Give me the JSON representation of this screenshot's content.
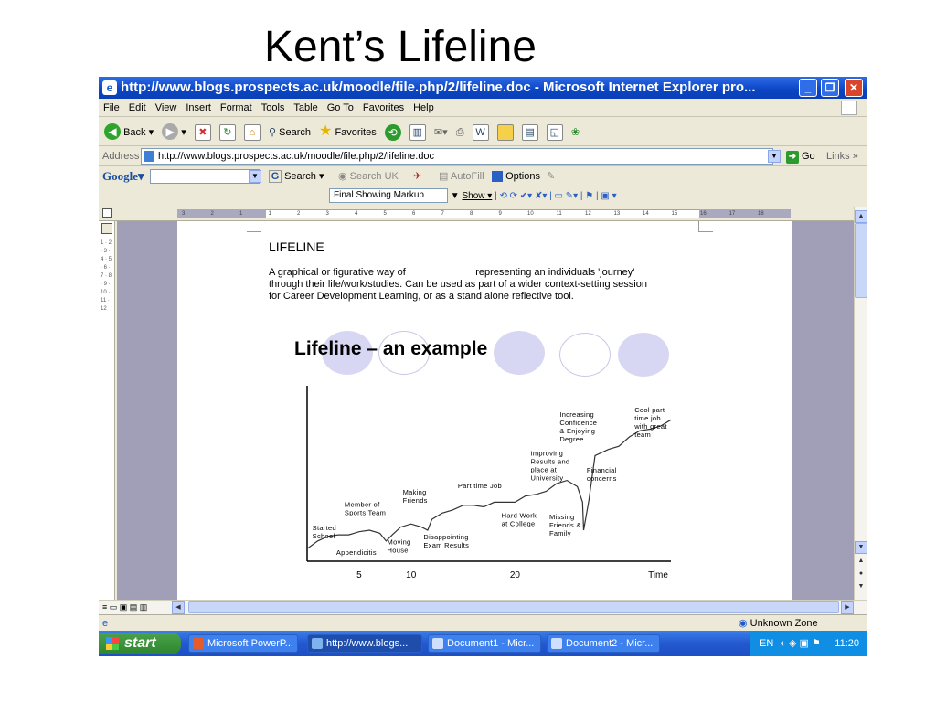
{
  "slide": {
    "title": "Kent’s Lifeline"
  },
  "window": {
    "title": "http://www.blogs.prospects.ac.uk/moodle/file.php/2/lifeline.doc - Microsoft Internet Explorer pro..."
  },
  "menu": [
    "File",
    "Edit",
    "View",
    "Insert",
    "Format",
    "Tools",
    "Table",
    "Go To",
    "Favorites",
    "Help"
  ],
  "toolbar": {
    "back": "Back",
    "search": "Search",
    "favorites": "Favorites"
  },
  "address": {
    "label": "Address",
    "url": "http://www.blogs.prospects.ac.uk/moodle/file.php/2/lifeline.doc",
    "go": "Go",
    "links": "Links"
  },
  "google": {
    "logo": "Google",
    "search": "Search",
    "search_uk": "Search UK",
    "autofill": "AutoFill",
    "options": "Options"
  },
  "review": {
    "markup": "Final Showing Markup",
    "show": "Show"
  },
  "ruler_numbers": [
    "3",
    "2",
    "1",
    "1",
    "2",
    "3",
    "4",
    "5",
    "6",
    "7",
    "8",
    "9",
    "10",
    "11",
    "12",
    "13",
    "14",
    "15",
    "16",
    "17",
    "18"
  ],
  "vruler_text": "1 · 2 · 3 · 4 · 5 · 6 · 7 · 8 · 9 · 10 · 11 · 12",
  "doc": {
    "heading": "LIFELINE",
    "para_lines": [
      "A graphical or figurative way of                         representing an individuals 'journey'",
      "through their life/work/studies.  Can be used as part of a wider context-setting session",
      "for Career Development Learning, or as a stand alone reflective tool."
    ],
    "lifeline_title": "Lifeline – an example"
  },
  "chart_data": {
    "type": "line",
    "title": "",
    "xlabel": "Time",
    "ylabel": "",
    "x_ticks": [
      5,
      10,
      20
    ],
    "xlim": [
      0,
      32
    ],
    "ylim": [
      0,
      1
    ],
    "series": [
      {
        "x": [
          0,
          1,
          2,
          3,
          4,
          4.5,
          5,
          6,
          7,
          7.6,
          8.2,
          9,
          10,
          11,
          11.6,
          12,
          13,
          14,
          15,
          16,
          17,
          18,
          19,
          20,
          21,
          22,
          23,
          24,
          25,
          26,
          26.5,
          26.6,
          27.1,
          27.7,
          29,
          30,
          31,
          32,
          33,
          34,
          35
        ],
        "y": [
          0.08,
          0.13,
          0.16,
          0.17,
          0.17,
          0.18,
          0.19,
          0.2,
          0.18,
          0.13,
          0.17,
          0.22,
          0.24,
          0.22,
          0.2,
          0.27,
          0.31,
          0.33,
          0.36,
          0.36,
          0.35,
          0.38,
          0.38,
          0.38,
          0.42,
          0.43,
          0.45,
          0.5,
          0.52,
          0.48,
          0.38,
          0.2,
          0.39,
          0.68,
          0.72,
          0.74,
          0.8,
          0.84,
          0.85,
          0.87,
          0.91
        ]
      }
    ],
    "annotations": [
      {
        "lines": [
          "Started",
          "School"
        ],
        "x": 0.5,
        "y": 0.2
      },
      {
        "lines": [
          "Appendicitis"
        ],
        "x": 2.8,
        "y": 0.04
      },
      {
        "lines": [
          "Member of",
          "Sports Team"
        ],
        "x": 3.6,
        "y": 0.35
      },
      {
        "lines": [
          "Moving",
          "House"
        ],
        "x": 7.7,
        "y": 0.11
      },
      {
        "lines": [
          "Making",
          "Friends"
        ],
        "x": 9.2,
        "y": 0.43
      },
      {
        "lines": [
          "Disappointing",
          "Exam Results"
        ],
        "x": 11.2,
        "y": 0.14
      },
      {
        "lines": [
          "Part time Job"
        ],
        "x": 14.5,
        "y": 0.47
      },
      {
        "lines": [
          "Hard Work",
          "at College"
        ],
        "x": 18.7,
        "y": 0.28
      },
      {
        "lines": [
          "Improving",
          "Results and",
          "place at",
          "University"
        ],
        "x": 21.5,
        "y": 0.68
      },
      {
        "lines": [
          "Missing",
          "Friends &",
          "Family"
        ],
        "x": 23.3,
        "y": 0.27
      },
      {
        "lines": [
          "Increasing",
          "Confidence",
          "& Enjoying",
          "Degree"
        ],
        "x": 24.3,
        "y": 0.93
      },
      {
        "lines": [
          "Financial",
          "concerns"
        ],
        "x": 26.9,
        "y": 0.57
      },
      {
        "lines": [
          "Cool part",
          "time job",
          "with great",
          "team"
        ],
        "x": 31.5,
        "y": 0.96
      }
    ]
  },
  "status": {
    "zone": "Unknown Zone"
  },
  "taskbar": {
    "start": "start",
    "tasks": [
      "Microsoft PowerP...",
      "http://www.blogs...",
      "Document1 - Micr...",
      "Document2 - Micr..."
    ],
    "lang": "EN",
    "clock": "11:20"
  }
}
